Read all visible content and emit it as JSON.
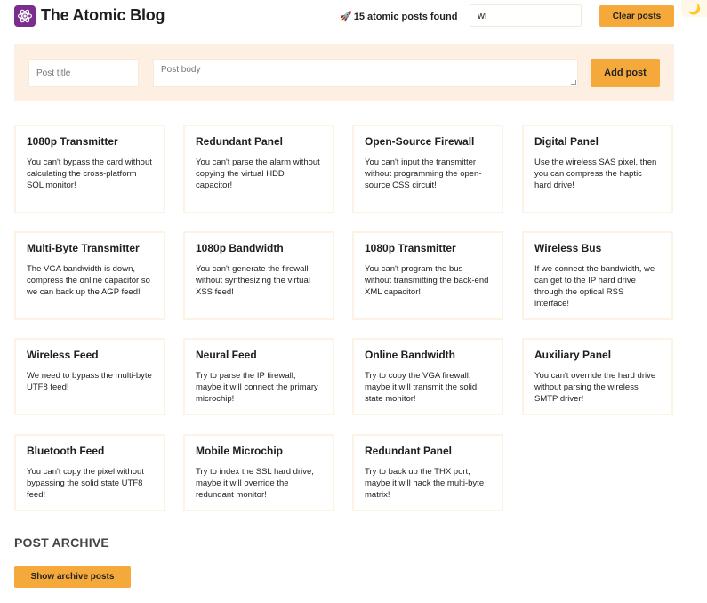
{
  "header": {
    "title": "The Atomic Blog",
    "logo_icon": "atom-icon",
    "results_icon": "rocket-icon",
    "results_text": "15 atomic posts found",
    "search_value": "wi",
    "clear_label": "Clear posts",
    "theme_icon": "moon-icon"
  },
  "form": {
    "title_placeholder": "Post title",
    "body_placeholder": "Post body",
    "add_label": "Add post"
  },
  "posts": [
    {
      "title": "1080p Transmitter",
      "body": "You can't bypass the card without calculating the cross-platform SQL monitor!"
    },
    {
      "title": "Redundant Panel",
      "body": "You can't parse the alarm without copying the virtual HDD capacitor!"
    },
    {
      "title": "Open-Source Firewall",
      "body": "You can't input the transmitter without programming the open-source CSS circuit!"
    },
    {
      "title": "Digital Panel",
      "body": "Use the wireless SAS pixel, then you can compress the haptic hard drive!"
    },
    {
      "title": "Multi-Byte Transmitter",
      "body": "The VGA bandwidth is down, compress the online capacitor so we can back up the AGP feed!"
    },
    {
      "title": "1080p Bandwidth",
      "body": "You can't generate the firewall without synthesizing the virtual XSS feed!"
    },
    {
      "title": "1080p Transmitter",
      "body": "You can't program the bus without transmitting the back-end XML capacitor!"
    },
    {
      "title": "Wireless Bus",
      "body": "If we connect the bandwidth, we can get to the IP hard drive through the optical RSS interface!"
    },
    {
      "title": "Wireless Feed",
      "body": "We need to bypass the multi-byte UTF8 feed!"
    },
    {
      "title": "Neural Feed",
      "body": "Try to parse the IP firewall, maybe it will connect the primary microchip!"
    },
    {
      "title": "Online Bandwidth",
      "body": "Try to copy the VGA firewall, maybe it will transmit the solid state monitor!"
    },
    {
      "title": "Auxiliary Panel",
      "body": "You can't override the hard drive without parsing the wireless SMTP driver!"
    },
    {
      "title": "Bluetooth Feed",
      "body": "You can't copy the pixel without bypassing the solid state UTF8 feed!"
    },
    {
      "title": "Mobile Microchip",
      "body": "Try to index the SSL hard drive, maybe it will override the redundant monitor!"
    },
    {
      "title": "Redundant Panel",
      "body": "Try to back up the THX port, maybe it will hack the multi-byte matrix!"
    }
  ],
  "archive": {
    "heading": "POST ARCHIVE",
    "show_label": "Show archive posts"
  }
}
